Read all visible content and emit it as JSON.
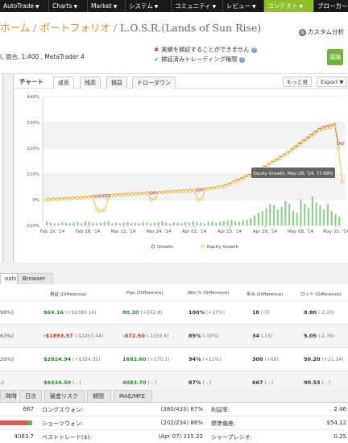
{
  "nav": {
    "items": [
      {
        "label": "AutoTrade",
        "caret": "▼"
      },
      {
        "label": "Charts",
        "caret": "▼"
      },
      {
        "label": "Market",
        "caret": "▼"
      },
      {
        "label": "システム",
        "caret": "▼"
      },
      {
        "label": "コミュニティ",
        "caret": "▼"
      },
      {
        "label": "レビュー",
        "caret": "▼"
      },
      {
        "label": "コンテスト",
        "caret": "▼"
      },
      {
        "label": "ブローカー",
        "caret": ""
      }
    ]
  },
  "header": {
    "home": "ホーム",
    "sep1": " / ",
    "portfolio": "ポートフォリオ",
    "sep2": " / ",
    "title": "L.O.S.R.(Lands of Sun Rise)",
    "custom_analysis": "カスタム分析",
    "meta": "i, 混合, 1:400 , MetaTrader 4",
    "verify_fail": "実績を検証することができません",
    "verify_ok": "検証済みトレーディング権限",
    "discuss_btn": "議論",
    "help_q": "?"
  },
  "chart_panel": {
    "label": "チャート",
    "tabs": [
      "成長",
      "残高",
      "損益",
      "ドローダウン"
    ],
    "more_btn": "もっと見",
    "export_btn": "Export ▼"
  },
  "chart_data": {
    "type": "line",
    "yticks": [
      "440%",
      "330%",
      "220%",
      "110%",
      "0%",
      "-110%"
    ],
    "ylim": [
      -110,
      440
    ],
    "xticks": [
      "Feb 16, '14",
      "Feb 28, '14",
      "Mar 12, '14",
      "Mar 24, '14",
      "Apr 03, '14",
      "Apr 15, '14",
      "Apr 28, '14",
      "May 08, '14",
      "May 20, '14"
    ],
    "series": [
      {
        "name": "Growth",
        "color": "#d9534f",
        "values": [
          0,
          1,
          2,
          3,
          4,
          5,
          6,
          7,
          8,
          9,
          10,
          12,
          14,
          15,
          16,
          17,
          18,
          19,
          20,
          21,
          22,
          23,
          24,
          25,
          26,
          27,
          28,
          29,
          30,
          31,
          32,
          33,
          34,
          35,
          36,
          37,
          38,
          39,
          40,
          42,
          44,
          46,
          48,
          50,
          53,
          56,
          60,
          66,
          75,
          82,
          88,
          96,
          104,
          112,
          120,
          130,
          140,
          150,
          160,
          170,
          180,
          190,
          200,
          212,
          225,
          238,
          250,
          262,
          275,
          287,
          300,
          308,
          312,
          316,
          320,
          240,
          240
        ]
      },
      {
        "name": "Equity Growth",
        "color": "#e8c43a",
        "values": [
          0,
          0,
          1,
          2,
          3,
          4,
          5,
          6,
          7,
          8,
          9,
          11,
          13,
          -40,
          -50,
          -45,
          5,
          18,
          19,
          20,
          21,
          22,
          23,
          24,
          25,
          26,
          27,
          0,
          5,
          30,
          31,
          32,
          33,
          34,
          35,
          36,
          37,
          38,
          39,
          0,
          5,
          45,
          47,
          49,
          52,
          55,
          59,
          65,
          74,
          80,
          86,
          94,
          102,
          110,
          118,
          128,
          138,
          148,
          158,
          168,
          178,
          188,
          198,
          210,
          222,
          234,
          246,
          258,
          270,
          282,
          295,
          300,
          305,
          310,
          315,
          220,
          77.68
        ]
      }
    ],
    "bars": [
      6,
      4,
      3,
      3,
      5,
      4,
      3,
      4,
      5,
      3,
      6,
      5,
      4,
      3,
      4,
      5,
      6,
      3,
      4,
      3,
      4,
      5,
      3,
      4,
      3,
      5,
      4,
      3,
      4,
      5,
      6,
      4,
      3,
      5,
      4,
      3,
      5,
      4,
      6,
      5,
      4,
      3,
      5,
      6,
      4,
      5,
      6,
      7,
      8,
      6,
      5,
      7,
      8,
      10,
      14,
      18,
      20,
      24,
      30,
      28,
      22,
      26,
      34,
      30,
      20,
      18,
      36,
      30,
      24,
      40,
      32,
      28,
      22,
      30,
      20,
      16,
      12
    ],
    "bar_color": "#8fd08f",
    "tooltip": "Equity Growth, May 28, '14, 77.68%",
    "legend": [
      "Growth",
      "Equity Growth"
    ],
    "legend_placement": "bottom"
  },
  "stats": {
    "tabs": [
      "oals",
      "Browser"
    ],
    "headers": [
      "損益 (Difference)",
      "Pips (Difference)",
      "Win % (Difference)",
      "歩み (Difference)",
      "ロット (Difference)"
    ],
    "rows": [
      {
        "c0": "98%)",
        "profit": "$64.16",
        "profit_diff": "(+$2089.14)",
        "pips": "80.20",
        "pips_diff": "(+552.8)",
        "win": "100%",
        "win_diff": "(+27%)",
        "trades": "10",
        "trades_diff": "(-5)",
        "lots": "0.80",
        "lots_diff": "(-2.20)",
        "profit_sign": "pos",
        "pips_sign": "pos"
      },
      {
        "c0": "63%)",
        "profit": "-$1893.57",
        "profit_diff": "(-$2457.44)",
        "pips": "-872.50",
        "pips_diff": "(-1153.6)",
        "win": "85%",
        "win_diff": "(-10%)",
        "trades": "34",
        "trades_diff": "(-15)",
        "lots": "5.05",
        "lots_diff": "(-2.76)",
        "profit_sign": "neg",
        "pips_sign": "neg"
      },
      {
        "c0": "29%)",
        "profit": "$2824.94",
        "profit_diff": "(+$324.35)",
        "pips": "1682.60",
        "pips_diff": "(+370.1)",
        "win": "94%",
        "win_diff": "(+11%)",
        "trades": "300",
        "trades_diff": "(+66)",
        "lots": "50.20",
        "lots_diff": "(+21.34)",
        "profit_sign": "pos",
        "pips_sign": "pos"
      },
      {
        "c0": "-)",
        "profit": "$6434.50",
        "profit_diff": "( - )",
        "pips": "4083.70",
        "pips_diff": "( - )",
        "win": "87%",
        "win_diff": "( - )",
        "trades": "667",
        "trades_diff": "( - )",
        "lots": "90.53",
        "lots_diff": "( - )",
        "profit_sign": "pos",
        "pips_sign": "pos"
      }
    ]
  },
  "bottom": {
    "tabs": [
      "時時",
      "日次",
      "破産リスク",
      "期間",
      "MAE/MFE"
    ],
    "rows": [
      {
        "left_val": "667",
        "label": "ロングスウォン:",
        "mid": "(380/433) 87%",
        "r_label": "利益率:",
        "r_val": "2.46"
      },
      {
        "left_val": "",
        "label": "ショーツウォン:",
        "mid": "(202/234) 86%",
        "r_label": "標準偏差:",
        "r_val": "$54.12"
      },
      {
        "left_val": "4083.7",
        "label": "ベストトレード($):",
        "mid": "(Apr 07) 215.22",
        "r_label": "シャープレシオ:",
        "r_val": "0.25"
      }
    ],
    "progress": 0.87
  }
}
